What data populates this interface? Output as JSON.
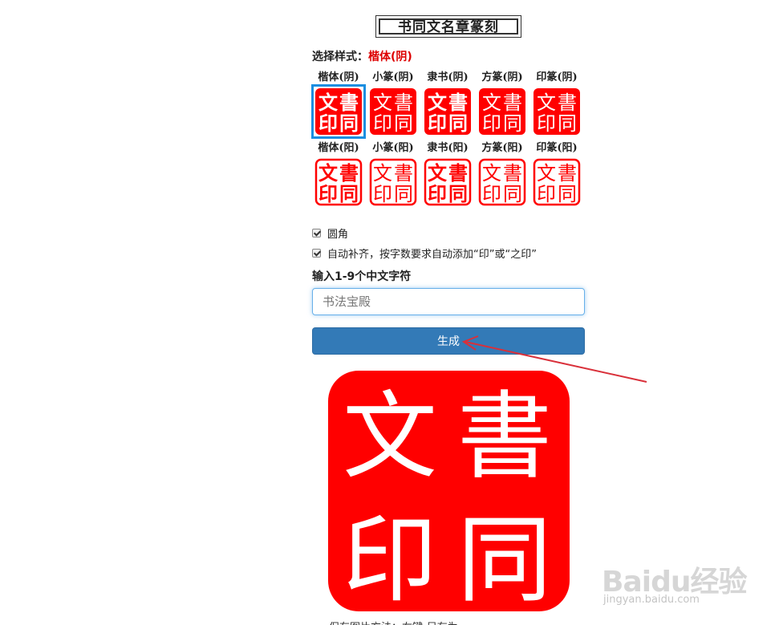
{
  "header": {
    "title": "书同文名章篆刻"
  },
  "style_select": {
    "label": "选择样式：",
    "selected": "楷体(阴)"
  },
  "seal_styles": {
    "row_yin": [
      {
        "label": "楷体(阴)",
        "variant": "yin",
        "font": "kai",
        "selected": true
      },
      {
        "label": "小篆(阴)",
        "variant": "yin",
        "font": "xiaozhuan",
        "selected": false
      },
      {
        "label": "隶书(阴)",
        "variant": "yin",
        "font": "lishu",
        "selected": false
      },
      {
        "label": "方篆(阴)",
        "variant": "yin",
        "font": "fangzhuan",
        "selected": false
      },
      {
        "label": "印篆(阴)",
        "variant": "yin",
        "font": "yinzhuan",
        "selected": false
      }
    ],
    "row_yang": [
      {
        "label": "楷体(阳)",
        "variant": "yang",
        "font": "kai",
        "selected": false
      },
      {
        "label": "小篆(阳)",
        "variant": "yang",
        "font": "xiaozhuan",
        "selected": false
      },
      {
        "label": "隶书(阳)",
        "variant": "yang",
        "font": "lishu",
        "selected": false
      },
      {
        "label": "方篆(阳)",
        "variant": "yang",
        "font": "fangzhuan",
        "selected": false
      },
      {
        "label": "印篆(阳)",
        "variant": "yang",
        "font": "yinzhuan",
        "selected": false
      }
    ]
  },
  "seal_characters": {
    "top_left": "文",
    "top_right": "書",
    "bottom_left": "印",
    "bottom_right": "同"
  },
  "options": {
    "rounded_label": "圆角",
    "rounded_checked": true,
    "autofill_label": "自动补齐，按字数要求自动添加“印”或“之印”",
    "autofill_checked": true
  },
  "input": {
    "label": "输入1-9个中文字符",
    "placeholder": "书法宝殿",
    "value": ""
  },
  "generate_button": {
    "label": "生成"
  },
  "footer": {
    "hint": "保存图片方法：右键-另存为"
  },
  "watermark": {
    "text": "Baidu经验",
    "url_text": "jingyan.baidu.com"
  },
  "colors": {
    "seal_red": "#ff0000",
    "button_blue": "#337ab7",
    "selected_outline": "#1a8ee0",
    "style_selected_text": "#dd0000",
    "annotation_arrow": "#d9303a"
  },
  "icons": {
    "checkbox": "checkmark-icon",
    "annotation": "arrow-icon"
  }
}
